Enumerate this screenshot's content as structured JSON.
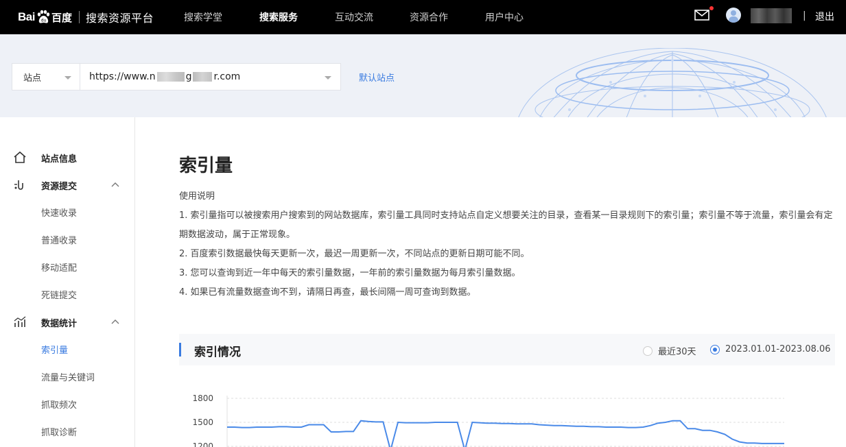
{
  "header": {
    "logo_bai": "Bai",
    "logo_du": "百度",
    "platform_title": "搜索资源平台",
    "nav": [
      {
        "label": "搜索学堂",
        "active": false
      },
      {
        "label": "搜索服务",
        "active": true
      },
      {
        "label": "互动交流",
        "active": false
      },
      {
        "label": "资源合作",
        "active": false
      },
      {
        "label": "用户中心",
        "active": false
      }
    ],
    "divider": "|",
    "logout": "退出"
  },
  "site_bar": {
    "select_label": "站点",
    "url_prefix": "https://www.",
    "url_mid1": "n",
    "url_mid2": "g",
    "url_suffix": "r.com",
    "default_site": "默认站点"
  },
  "sidebar": {
    "groups": [
      {
        "label": "站点信息",
        "icon": "home-icon"
      },
      {
        "label": "资源提交",
        "icon": "link-icon",
        "items": [
          "快速收录",
          "普通收录",
          "移动适配",
          "死链提交"
        ]
      },
      {
        "label": "数据统计",
        "icon": "bar-chart-icon",
        "items": [
          "索引量",
          "流量与关键词",
          "抓取频次",
          "抓取诊断"
        ]
      }
    ],
    "active_item": "索引量"
  },
  "main": {
    "title": "索引量",
    "notes_heading": "使用说明",
    "notes": [
      "1. 索引量指可以被搜索用户搜索到的网站数据库，索引量工具同时支持站点自定义想要关注的目录，查看某一目录规则下的索引量；索引量不等于流量，索引量会有定期数据波动，属于正常现象。",
      "2. 百度索引数据最快每天更新一次，最迟一周更新一次，不同站点的更新日期可能不同。",
      "3. 您可以查询到近一年中每天的索引量数据，一年前的索引量数据为每月索引量数据。",
      "4. 如果已有流量数据查询不到，请隔日再查，最长间隔一周可查询到数据。"
    ],
    "section_title": "索引情况",
    "radio_options": [
      {
        "label": "最近30天",
        "checked": false
      },
      {
        "label": "2023.01.01-2023.08.06",
        "checked": true
      }
    ]
  },
  "colors": {
    "accent": "#3a7be0",
    "topbar": "#000000",
    "line": "#4a8ae8"
  },
  "chart_data": {
    "type": "line",
    "ylim": [
      1200,
      1800
    ],
    "y_ticks": [
      1800,
      1500,
      1200
    ],
    "series": [
      {
        "values": [
          1440,
          1440,
          1435,
          1435,
          1440,
          1440,
          1440,
          1445,
          1445,
          1440,
          1440,
          1470,
          1470,
          1470,
          1380,
          1380,
          1385,
          1385,
          1520,
          1510,
          1505,
          1505,
          1150,
          1500,
          1495,
          1495,
          1495,
          1495,
          1500,
          1500,
          1500,
          1500,
          1150,
          1500,
          1495,
          1490,
          1490,
          1485,
          1485,
          1480,
          1480,
          1480,
          1470,
          1465,
          1460,
          1460,
          1455,
          1450,
          1450,
          1445,
          1445,
          1440,
          1440,
          1440,
          1435,
          1435,
          1440,
          1460,
          1490,
          1500,
          1520,
          1520,
          1420,
          1420,
          1400,
          1400,
          1380,
          1350,
          1290,
          1255,
          1240,
          1240,
          1235,
          1235,
          1235,
          1235
        ]
      }
    ]
  }
}
